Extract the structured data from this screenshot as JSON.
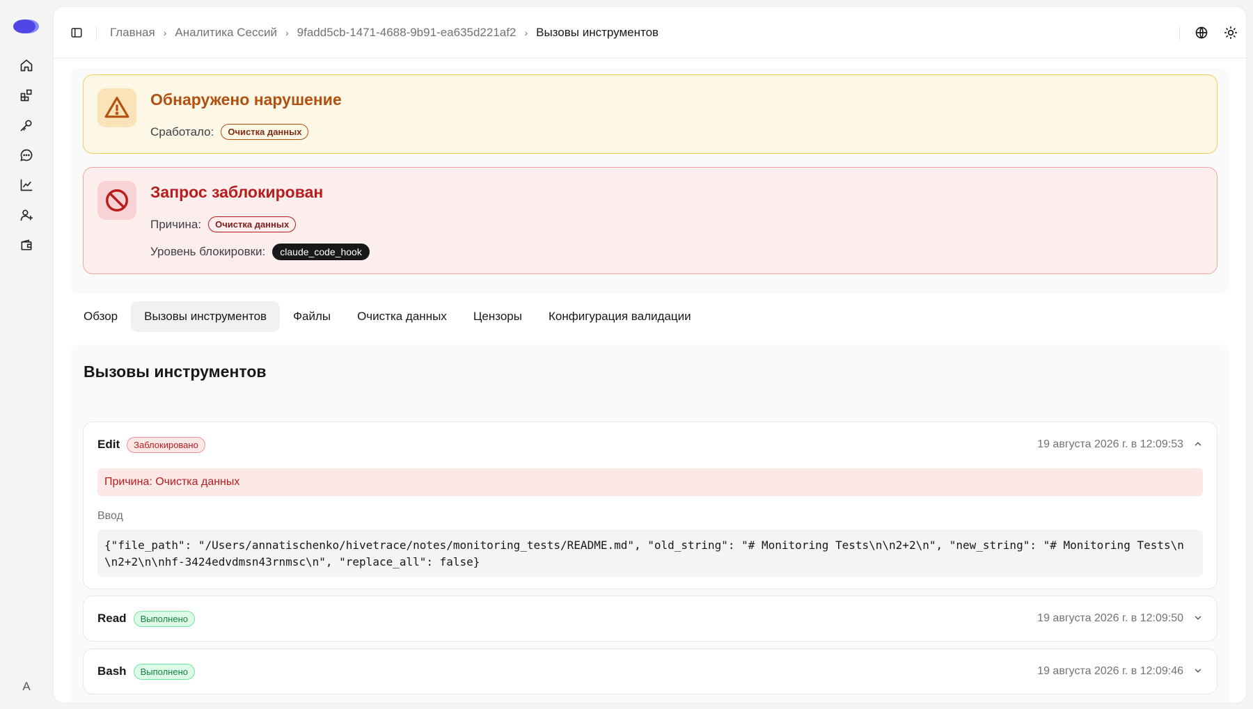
{
  "breadcrumb": {
    "items": [
      "Главная",
      "Аналитика Сессий",
      "9fadd5cb-1471-4688-9b91-ea635d221af2"
    ],
    "current": "Вызовы инструментов"
  },
  "alerts": {
    "violation": {
      "title": "Обнаружено нарушение",
      "triggered_label": "Сработало:",
      "triggered_value": "Очистка данных"
    },
    "blocked": {
      "title": "Запрос заблокирован",
      "reason_label": "Причина:",
      "reason_value": "Очистка данных",
      "level_label": "Уровень блокировки:",
      "level_value": "claude_code_hook"
    }
  },
  "tabs": [
    {
      "label": "Обзор",
      "active": false
    },
    {
      "label": "Вызовы инструментов",
      "active": true
    },
    {
      "label": "Файлы",
      "active": false
    },
    {
      "label": "Очистка данных",
      "active": false
    },
    {
      "label": "Цензоры",
      "active": false
    },
    {
      "label": "Конфигурация валидации",
      "active": false
    }
  ],
  "section": {
    "title": "Вызовы инструментов"
  },
  "calls": [
    {
      "name": "Edit",
      "status": "Заблокировано",
      "status_kind": "blocked",
      "time": "19 августа 2026 г. в 12:09:53",
      "expanded": true,
      "reason": "Причина: Очистка данных",
      "input_label": "Ввод",
      "input": "{\"file_path\": \"/Users/annatischenko/hivetrace/notes/monitoring_tests/README.md\", \"old_string\": \"# Monitoring Tests\\n\\n2+2\\n\", \"new_string\": \"# Monitoring Tests\\n\\n2+2\\n\\nhf-3424edvdmsn43rnmsc\\n\", \"replace_all\": false}"
    },
    {
      "name": "Read",
      "status": "Выполнено",
      "status_kind": "done",
      "time": "19 августа 2026 г. в 12:09:50",
      "expanded": false
    },
    {
      "name": "Bash",
      "status": "Выполнено",
      "status_kind": "done",
      "time": "19 августа 2026 г. в 12:09:46",
      "expanded": false
    }
  ],
  "user": {
    "avatar_initial": "A"
  },
  "colors": {
    "accent": "#4f46e5",
    "warning_border": "#f1cf54",
    "danger_border": "#f0a3a3",
    "danger_text": "#b91c1c",
    "success_text": "#15803d"
  },
  "icons": {
    "rail": [
      "home-icon",
      "integrations-icon",
      "key-icon",
      "chat-icon",
      "analytics-icon",
      "add-user-icon",
      "wallet-icon"
    ],
    "top": [
      "globe-icon",
      "sun-icon"
    ]
  }
}
